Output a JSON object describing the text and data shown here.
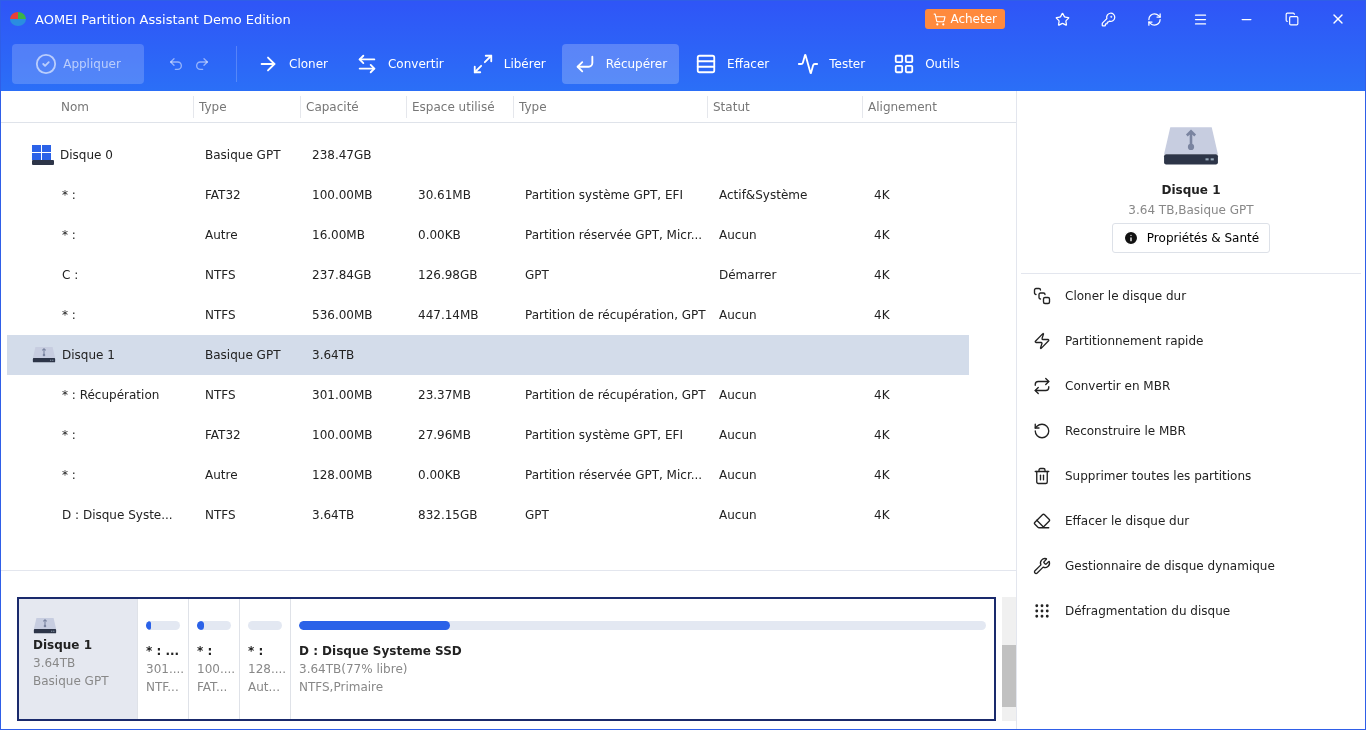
{
  "window": {
    "title": "AOMEI Partition Assistant Demo Edition"
  },
  "buy_button": {
    "label": "Acheter"
  },
  "toolbar": {
    "apply": {
      "label": "Appliquer",
      "disabled": true
    },
    "tools": [
      {
        "label": "Cloner",
        "selected": false
      },
      {
        "label": "Convertir",
        "selected": false
      },
      {
        "label": "Libérer",
        "selected": false
      },
      {
        "label": "Récupérer",
        "selected": true
      },
      {
        "label": "Effacer",
        "selected": false
      },
      {
        "label": "Tester",
        "selected": false
      },
      {
        "label": "Outils",
        "selected": false
      }
    ]
  },
  "table": {
    "columns": [
      "Nom",
      "Type",
      "Capacité",
      "Espace utilisé",
      "Type",
      "Statut",
      "Alignement"
    ],
    "rows": [
      {
        "kind": "disk",
        "selected": false,
        "cells": [
          "Disque 0",
          "Basique GPT",
          "238.47GB",
          "",
          "",
          "",
          ""
        ]
      },
      {
        "kind": "partition",
        "selected": false,
        "cells": [
          "* :",
          "FAT32",
          "100.00MB",
          "30.61MB",
          "Partition système GPT, EFI",
          "Actif&Système",
          "4K"
        ]
      },
      {
        "kind": "partition",
        "selected": false,
        "cells": [
          "* :",
          "Autre",
          "16.00MB",
          "0.00KB",
          "Partition réservée GPT, Micr...",
          "Aucun",
          "4K"
        ]
      },
      {
        "kind": "partition",
        "selected": false,
        "cells": [
          "C :",
          "NTFS",
          "237.84GB",
          "126.98GB",
          "GPT",
          "Démarrer",
          "4K"
        ]
      },
      {
        "kind": "partition",
        "selected": false,
        "cells": [
          "* :",
          "NTFS",
          "536.00MB",
          "447.14MB",
          "Partition de récupération, GPT",
          "Aucun",
          "4K"
        ]
      },
      {
        "kind": "usb-disk",
        "selected": true,
        "cells": [
          "Disque 1",
          "Basique GPT",
          "3.64TB",
          "",
          "",
          "",
          ""
        ]
      },
      {
        "kind": "partition",
        "selected": false,
        "cells": [
          "* : Récupération",
          "NTFS",
          "301.00MB",
          "23.37MB",
          "Partition de récupération, GPT",
          "Aucun",
          "4K"
        ]
      },
      {
        "kind": "partition",
        "selected": false,
        "cells": [
          "* :",
          "FAT32",
          "100.00MB",
          "27.96MB",
          "Partition système GPT, EFI",
          "Aucun",
          "4K"
        ]
      },
      {
        "kind": "partition",
        "selected": false,
        "cells": [
          "* :",
          "Autre",
          "128.00MB",
          "0.00KB",
          "Partition réservée GPT, Micr...",
          "Aucun",
          "4K"
        ]
      },
      {
        "kind": "partition",
        "selected": false,
        "cells": [
          "D : Disque Syste...",
          "NTFS",
          "3.64TB",
          "832.15GB",
          "GPT",
          "Aucun",
          "4K"
        ]
      }
    ]
  },
  "disk_map": {
    "disk": {
      "name": "Disque 1",
      "size": "3.64TB",
      "style": "Basique GPT",
      "selected": true
    },
    "partitions": [
      {
        "name": "* : ...",
        "size": "301....",
        "fs": "NTF...",
        "level": 0.1
      },
      {
        "name": "* :",
        "size": "100....",
        "fs": "FAT...",
        "level": 0.2
      },
      {
        "name": "* :",
        "size": "128....",
        "fs": "Aut...",
        "level": 0
      },
      {
        "name": "D : Disque Systeme SSD",
        "size": "3.64TB(77% libre)",
        "fs": "NTFS,Primaire",
        "level": 0.22
      }
    ]
  },
  "side_panel": {
    "title": "Disque 1",
    "subtitle": "3.64 TB,Basique GPT",
    "button": "Propriétés & Santé",
    "actions": [
      "Cloner le disque dur",
      "Partitionnement rapide",
      "Convertir en MBR",
      "Reconstruire le MBR",
      "Supprimer toutes les partitions",
      "Effacer le disque dur",
      "Gestionnaire de disque dynamique",
      "Défragmentation du disque"
    ]
  }
}
